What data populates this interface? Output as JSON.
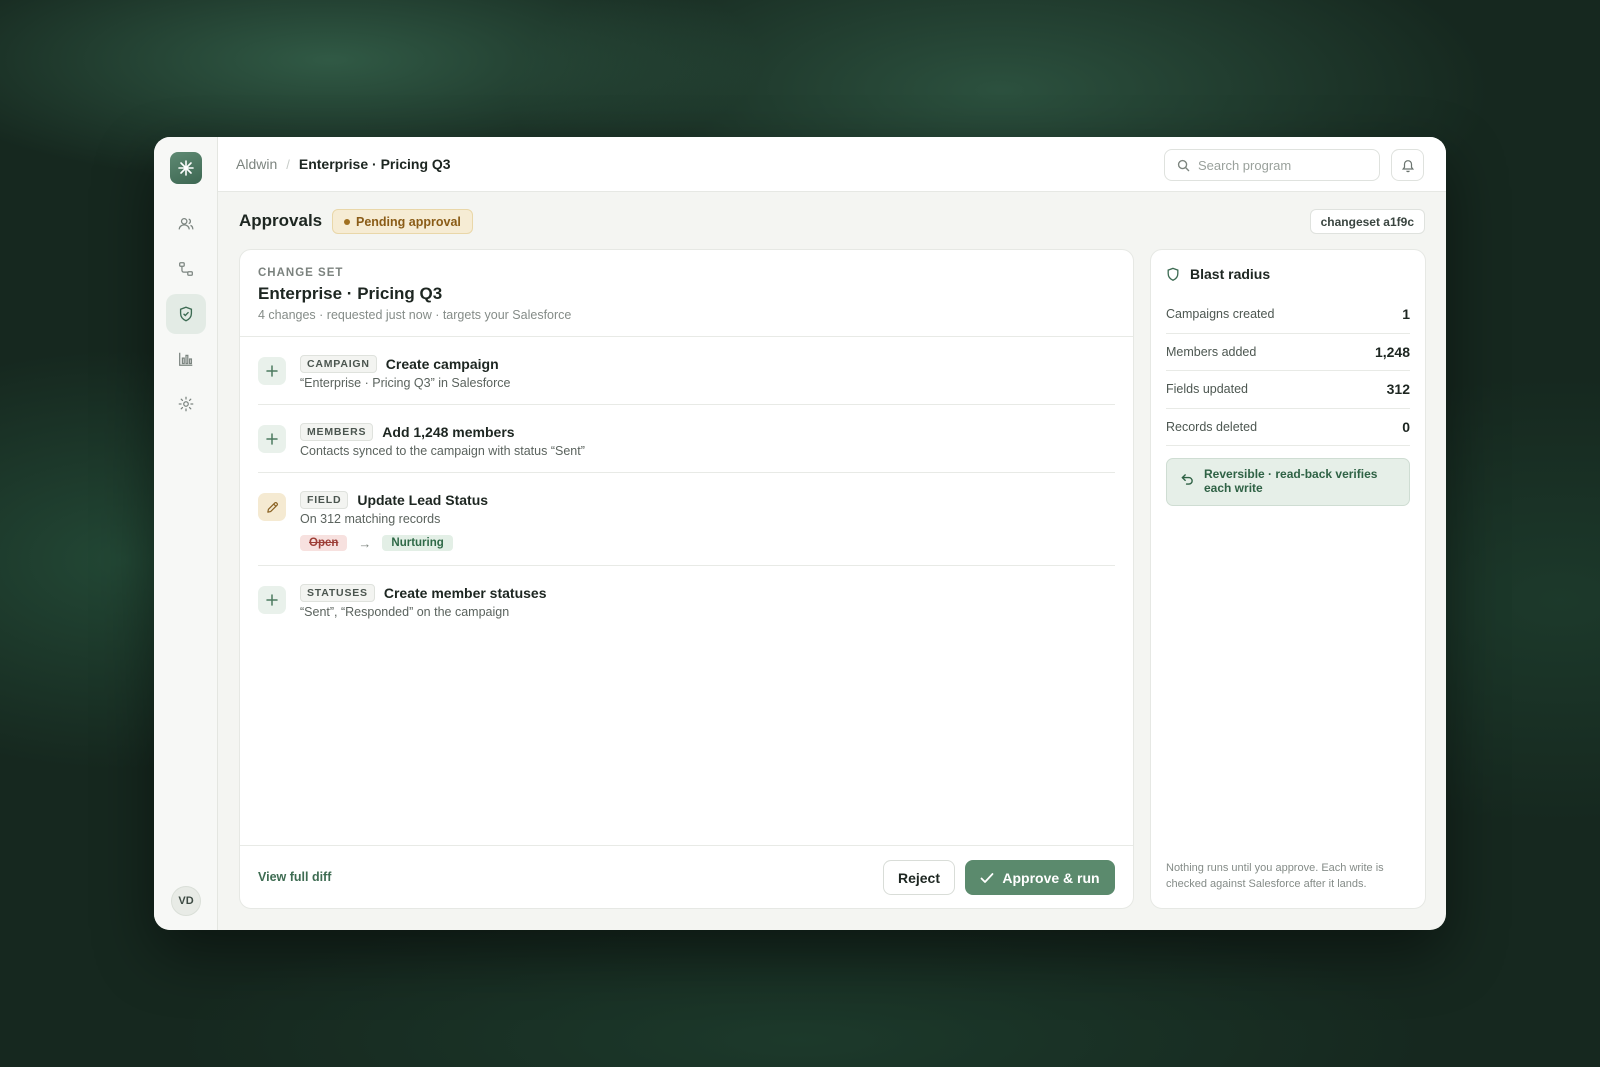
{
  "breadcrumb": {
    "root": "Aldwin",
    "separator": "/",
    "current": "Enterprise · Pricing Q3"
  },
  "search": {
    "placeholder": "Search program"
  },
  "rail": {
    "items": [
      {
        "name": "people-icon",
        "active": false
      },
      {
        "name": "flow-icon",
        "active": false
      },
      {
        "name": "shield-check-icon",
        "active": true
      },
      {
        "name": "bar-chart-icon",
        "active": false
      },
      {
        "name": "gear-icon",
        "active": false
      }
    ],
    "avatar": "VD"
  },
  "page": {
    "title": "Approvals",
    "status": "Pending approval",
    "changeset_id": "changeset a1f9c"
  },
  "changeset": {
    "eyebrow": "CHANGE SET",
    "title": "Enterprise · Pricing Q3",
    "meta": "4 changes · requested just now · targets your Salesforce",
    "changes": [
      {
        "kind": "CAMPAIGN",
        "title": "Create campaign",
        "desc": "“Enterprise · Pricing Q3” in Salesforce",
        "icon": "plus-icon"
      },
      {
        "kind": "MEMBERS",
        "title": "Add 1,248 members",
        "desc": "Contacts synced to the campaign with status “Sent”",
        "icon": "plus-icon"
      },
      {
        "kind": "FIELD",
        "title": "Update Lead Status",
        "desc": "On 312 matching records",
        "icon": "pencil-icon",
        "from": "Open",
        "to": "Nurturing"
      },
      {
        "kind": "STATUSES",
        "title": "Create member statuses",
        "desc": "“Sent”, “Responded” on the campaign",
        "icon": "plus-icon"
      }
    ],
    "view_diff": "View full diff",
    "reject": "Reject",
    "approve": "Approve & run"
  },
  "blast_radius": {
    "title": "Blast radius",
    "stats": [
      {
        "label": "Campaigns created",
        "value": "1"
      },
      {
        "label": "Members added",
        "value": "1,248"
      },
      {
        "label": "Fields updated",
        "value": "312"
      },
      {
        "label": "Records deleted",
        "value": "0"
      }
    ],
    "reversible": "Reversible · read-back verifies each write",
    "footnote": "Nothing runs until you approve. Each write is checked against Salesforce after it lands."
  },
  "colors": {
    "accent": "#5b8a6d",
    "pending_bg": "#f6ecd4",
    "pending_text": "#8a5c17",
    "danger": "#9d3e37"
  }
}
